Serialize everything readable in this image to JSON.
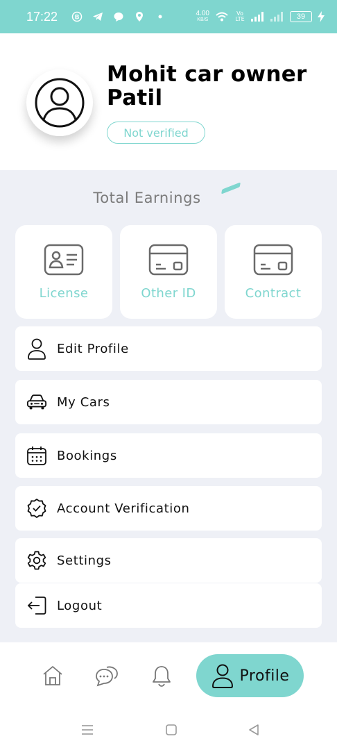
{
  "status_bar": {
    "time": "17:22",
    "speed_value": "4.00",
    "speed_unit": "KB/S",
    "network_label": "Vo LTE",
    "battery": "39"
  },
  "profile": {
    "name": "Mohit car owner Patil",
    "verification_status": "Not verified"
  },
  "earnings": {
    "title": "Total Earnings"
  },
  "documents": [
    {
      "label": "License",
      "icon": "id-card-icon"
    },
    {
      "label": "Other ID",
      "icon": "card-icon"
    },
    {
      "label": "Contract",
      "icon": "card-icon"
    }
  ],
  "menu": [
    {
      "label": "Edit Profile",
      "icon": "user-icon"
    },
    {
      "label": "My Cars",
      "icon": "car-icon"
    },
    {
      "label": "Bookings",
      "icon": "calendar-icon"
    },
    {
      "label": "Account Verification",
      "icon": "verified-badge-icon"
    },
    {
      "label": "Settings",
      "icon": "gear-icon"
    },
    {
      "label": "Logout",
      "icon": "logout-icon"
    }
  ],
  "bottom_nav": {
    "items": [
      "home-icon",
      "chat-icon",
      "bell-icon"
    ],
    "active_label": "Profile"
  },
  "colors": {
    "accent": "#7fd6cf",
    "background": "#eef0f6",
    "card": "#ffffff",
    "text": "#111111",
    "muted": "#7b7b7b"
  }
}
